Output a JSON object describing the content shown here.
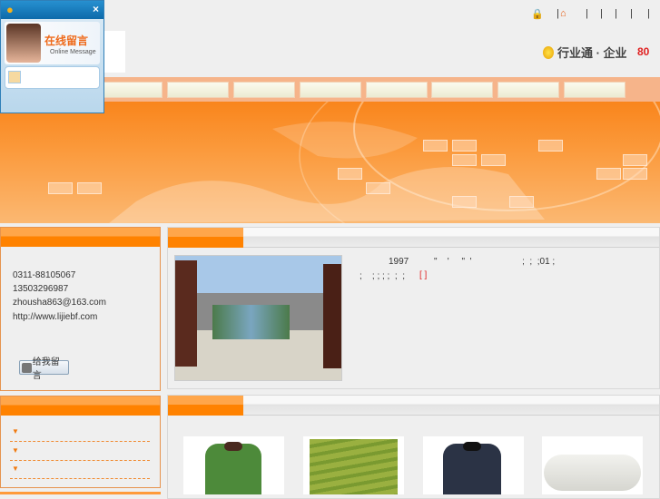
{
  "header": {
    "separators": [
      "|",
      "|",
      "|",
      "|",
      "|",
      "|"
    ],
    "brand": "行业通 · 企业",
    "count": "80"
  },
  "nav": {
    "items": [
      "",
      "",
      "",
      "",
      "",
      "",
      "",
      ""
    ]
  },
  "contact": {
    "title": "",
    "phone": "0311-88105067",
    "mobile": "13503296987",
    "email": "zhousha863@163.com",
    "website": "http://www.lijiebf.com",
    "message_button": "给我留言"
  },
  "about": {
    "title": "",
    "line1": "1997          \"    '     \"  '                    ;  ;  ;01 ;",
    "line2": ";    ; ; ; ;  ;  ;",
    "more": "[ ]"
  },
  "categories": {
    "title": "",
    "items": [
      "",
      "",
      ""
    ]
  },
  "products": {
    "title": "",
    "items": [
      {
        "name": "green coat"
      },
      {
        "name": "camouflage quilted"
      },
      {
        "name": "dark coat"
      },
      {
        "name": "cotton batting"
      }
    ]
  },
  "popup": {
    "title_cn": "在线留言",
    "title_en": "Online Message",
    "close": "×"
  },
  "colors": {
    "accent": "#ff8200",
    "popup": "#1a7dc0",
    "count": "#e02020"
  }
}
